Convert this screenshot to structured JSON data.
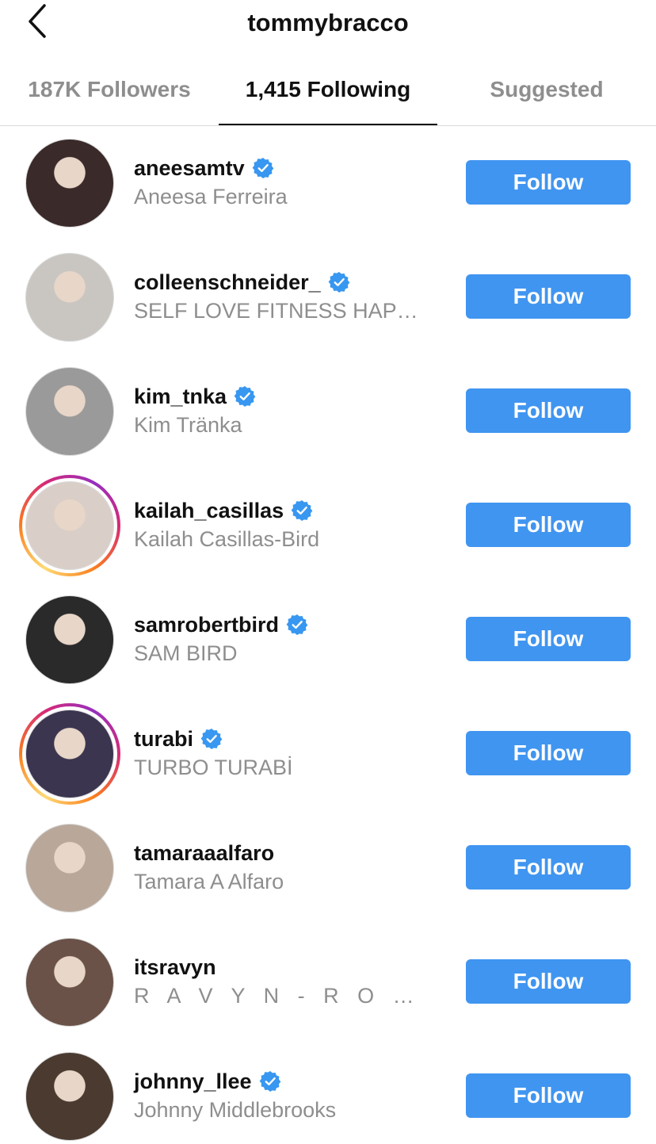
{
  "header": {
    "title": "tommybracco",
    "back_icon": "chevron-left-icon"
  },
  "tabs": [
    {
      "label": "187K Followers",
      "active": false
    },
    {
      "label": "1,415 Following",
      "active": true
    },
    {
      "label": "Suggested",
      "active": false
    }
  ],
  "colors": {
    "accent": "#4095f0",
    "verified": "#3897f0",
    "muted": "#8e8e8e"
  },
  "users": [
    {
      "username": "aneesamtv",
      "fullname": "Aneesa Ferreira",
      "verified": true,
      "story": false,
      "button": "Follow",
      "avatar_bg": "#3a2a2a"
    },
    {
      "username": "colleenschneider_",
      "fullname": "SELF LOVE FITNESS HAPPINESS",
      "verified": true,
      "story": false,
      "button": "Follow",
      "avatar_bg": "#c9c6c2"
    },
    {
      "username": "kim_tnka",
      "fullname": "Kim Tränka",
      "verified": true,
      "story": false,
      "button": "Follow",
      "avatar_bg": "#9a9a9a"
    },
    {
      "username": "kailah_casillas",
      "fullname": "Kailah Casillas-Bird",
      "verified": true,
      "story": true,
      "button": "Follow",
      "avatar_bg": "#d9cfc8"
    },
    {
      "username": "samrobertbird",
      "fullname": "SAM BIRD",
      "verified": true,
      "story": false,
      "button": "Follow",
      "avatar_bg": "#2a2a2a"
    },
    {
      "username": "turabi",
      "fullname": "TURBO TURABİ",
      "verified": true,
      "story": true,
      "button": "Follow",
      "avatar_bg": "#3b3550"
    },
    {
      "username": "tamaraaalfaro",
      "fullname": "Tamara A Alfaro",
      "verified": false,
      "story": false,
      "button": "Follow",
      "avatar_bg": "#b9a89a"
    },
    {
      "username": "itsravyn",
      "fullname": "R A V Y N - R O C H E L L E",
      "verified": false,
      "story": false,
      "button": "Follow",
      "avatar_bg": "#6a5248"
    },
    {
      "username": "johnny_llee",
      "fullname": "Johnny Middlebrooks",
      "verified": true,
      "story": false,
      "button": "Follow",
      "avatar_bg": "#4a3a30"
    }
  ]
}
